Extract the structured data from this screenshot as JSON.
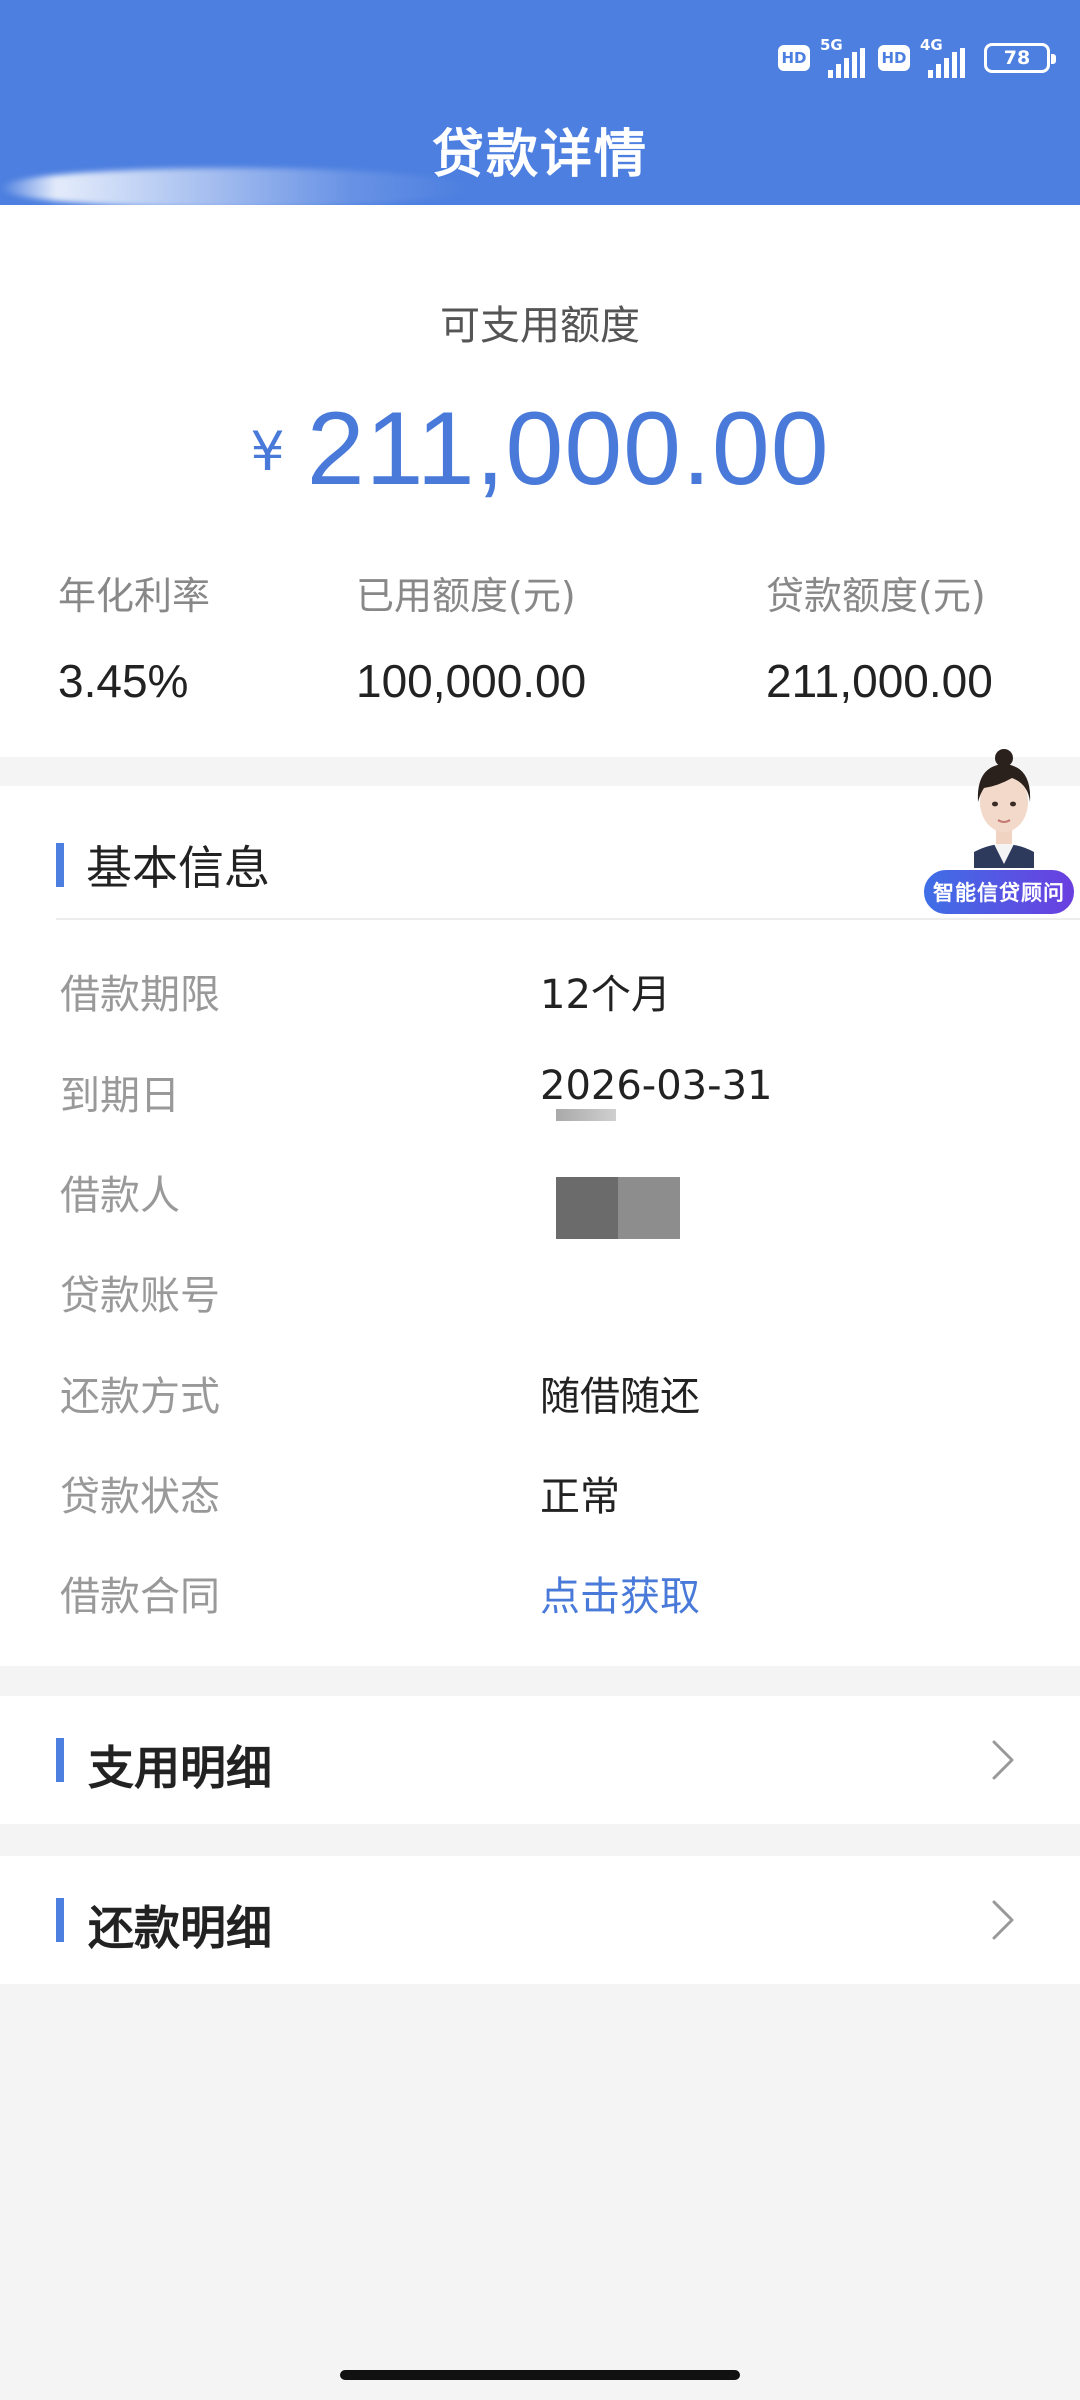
{
  "status_bar": {
    "hd1": "HD",
    "net1": "5G",
    "hd2": "HD",
    "net2": "4G",
    "battery": "78"
  },
  "header": {
    "title": "贷款详情"
  },
  "summary": {
    "available_label": "可支用额度",
    "currency_symbol": "¥",
    "available_amount": "211,000.00",
    "stats": [
      {
        "label": "年化利率",
        "value": "3.45%"
      },
      {
        "label": "已用额度(元)",
        "value": "100,000.00"
      },
      {
        "label": "贷款额度(元)",
        "value": "211,000.00"
      }
    ]
  },
  "basic_info": {
    "title": "基本信息",
    "rows": [
      {
        "label": "借款期限",
        "value": "12个月"
      },
      {
        "label": "到期日",
        "value": "2026-03-31"
      },
      {
        "label": "借款人",
        "value": ""
      },
      {
        "label": "贷款账号",
        "value": ""
      },
      {
        "label": "还款方式",
        "value": "随借随还"
      },
      {
        "label": "贷款状态",
        "value": "正常"
      },
      {
        "label": "借款合同",
        "value": "点击获取"
      }
    ]
  },
  "advisor": {
    "label": "智能信贷顾问"
  },
  "sections": {
    "disbursement": "支用明细",
    "repayment": "还款明细"
  },
  "colors": {
    "header_bg": "#4d7fe0",
    "accent": "#4a7ad9",
    "advisor_gradient_start": "#3f6fe6",
    "advisor_gradient_end": "#6a3fe0"
  },
  "icons": {
    "chevron": "chevron-right-icon",
    "signal": "signal-bars-icon",
    "battery": "battery-icon"
  }
}
